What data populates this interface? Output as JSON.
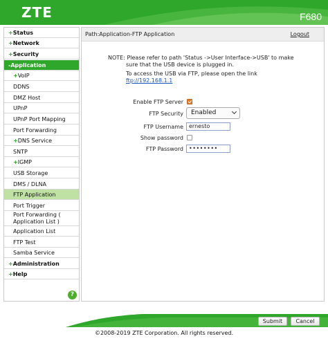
{
  "header": {
    "logo": "ZTE",
    "model": "F680",
    "brand_color": "#2fa72a"
  },
  "sidebar": {
    "items": [
      {
        "label": "Status",
        "level": "top",
        "expandable": true
      },
      {
        "label": "Network",
        "level": "top",
        "expandable": true
      },
      {
        "label": "Security",
        "level": "top",
        "expandable": true
      },
      {
        "label": "Application",
        "level": "top",
        "expandable": true,
        "open": true
      },
      {
        "label": "VoIP",
        "level": "sub",
        "expandable": true
      },
      {
        "label": "DDNS",
        "level": "sub"
      },
      {
        "label": "DMZ Host",
        "level": "sub"
      },
      {
        "label": "UPnP",
        "level": "sub"
      },
      {
        "label": "UPnP Port Mapping",
        "level": "sub"
      },
      {
        "label": "Port Forwarding",
        "level": "sub"
      },
      {
        "label": "DNS Service",
        "level": "sub",
        "expandable": true
      },
      {
        "label": "SNTP",
        "level": "sub"
      },
      {
        "label": "IGMP",
        "level": "sub",
        "expandable": true
      },
      {
        "label": "USB Storage",
        "level": "sub"
      },
      {
        "label": "DMS / DLNA",
        "level": "sub"
      },
      {
        "label": "FTP Application",
        "level": "sub",
        "selected": true
      },
      {
        "label": "Port Trigger",
        "level": "sub"
      },
      {
        "label": "Port Forwarding ( Application List )",
        "level": "sub"
      },
      {
        "label": "Application List",
        "level": "sub"
      },
      {
        "label": "FTP Test",
        "level": "sub"
      },
      {
        "label": "Samba Service",
        "level": "sub"
      },
      {
        "label": "Administration",
        "level": "top",
        "expandable": true
      },
      {
        "label": "Help",
        "level": "top",
        "expandable": true
      }
    ],
    "plus_symbol": "+",
    "help_icon": "?"
  },
  "pathbar": {
    "path": "Path:Application-FTP Application",
    "logout": "Logout"
  },
  "note": {
    "line1": "NOTE: Please refer to path 'Status ->User Interface->USB' to make",
    "line2": "sure that the USB device is plugged in.",
    "access": "To access the USB via FTP, please open the link",
    "link": "ftp://192.168.1.1"
  },
  "form": {
    "enable_label": "Enable FTP Server",
    "enable_checked": true,
    "security_label": "FTP Security",
    "security_value": "Enabled",
    "username_label": "FTP Username",
    "username_value": "ernesto",
    "show_password_label": "Show password",
    "show_password_checked": false,
    "password_label": "FTP Password",
    "password_masked": "••••••••"
  },
  "buttons": {
    "submit": "Submit",
    "cancel": "Cancel"
  },
  "footer": {
    "copyright": "©2008-2019 ZTE Corporation. All rights reserved."
  }
}
